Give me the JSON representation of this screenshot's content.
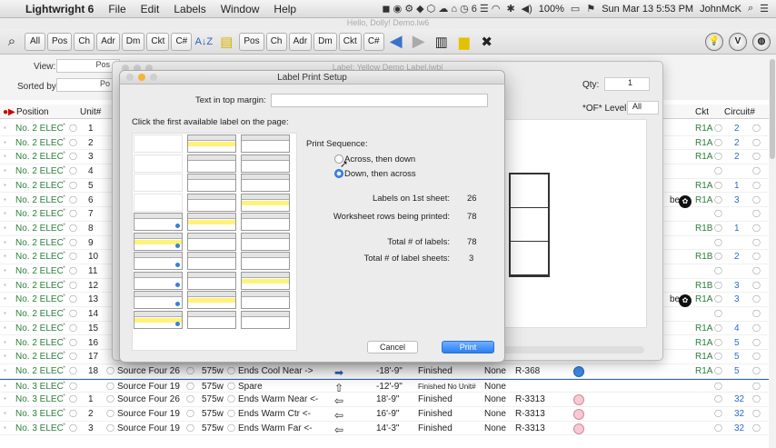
{
  "menubar": {
    "app_name": "Lightwright 6",
    "menus": [
      "File",
      "Edit",
      "Labels",
      "Window",
      "Help"
    ],
    "battery": "100%",
    "datetime": "Sun Mar 13  5:53 PM",
    "user": "JohnMcK"
  },
  "document_title": "Hello, Dolly! Demo.lw6",
  "toolbar": {
    "group1": [
      "All",
      "Pos",
      "Ch",
      "Adr",
      "Dm",
      "Ckt",
      "C#"
    ],
    "group2": [
      "Pos",
      "Ch",
      "Adr",
      "Dm",
      "Ckt",
      "C#"
    ]
  },
  "filters": {
    "view_label": "View:",
    "view_value": "Pos",
    "sorted_label": "Sorted by:",
    "sorted_value": "Po"
  },
  "columns": {
    "position": "Position",
    "unit": "Unit#",
    "ckt": "Ckt",
    "circuit": "Circuit#"
  },
  "rows": [
    {
      "pos": "No. 2 ELEC",
      "unit": "1",
      "ckt": "R1A",
      "cir": "2"
    },
    {
      "pos": "No. 2 ELEC",
      "unit": "2",
      "ckt": "R1A",
      "cir": "2"
    },
    {
      "pos": "No. 2 ELEC",
      "unit": "3",
      "ckt": "R1A",
      "cir": "2"
    },
    {
      "pos": "No. 2 ELEC",
      "unit": "4",
      "ckt": "",
      "cir": ""
    },
    {
      "pos": "No. 2 ELEC",
      "unit": "5",
      "ckt": "R1A",
      "cir": "1"
    },
    {
      "pos": "No. 2 ELEC",
      "unit": "6",
      "ckt": "R1A",
      "cir": "3"
    },
    {
      "pos": "No. 2 ELEC",
      "unit": "7",
      "ckt": "",
      "cir": ""
    },
    {
      "pos": "No. 2 ELEC",
      "unit": "8",
      "ckt": "R1B",
      "cir": "1"
    },
    {
      "pos": "No. 2 ELEC",
      "unit": "9",
      "ckt": "",
      "cir": ""
    },
    {
      "pos": "No. 2 ELEC",
      "unit": "10",
      "ckt": "R1B",
      "cir": "2"
    },
    {
      "pos": "No. 2 ELEC",
      "unit": "11",
      "ckt": "",
      "cir": ""
    },
    {
      "pos": "No. 2 ELEC",
      "unit": "12",
      "ckt": "R1B",
      "cir": "3"
    },
    {
      "pos": "No. 2 ELEC",
      "unit": "13",
      "ckt": "R1A",
      "cir": "3"
    },
    {
      "pos": "No. 2 ELEC",
      "unit": "14",
      "ckt": "",
      "cir": ""
    },
    {
      "pos": "No. 2 ELEC",
      "unit": "15",
      "ckt": "R1A",
      "cir": "4"
    },
    {
      "pos": "No. 2 ELEC",
      "unit": "16",
      "ckt": "R1A",
      "cir": "5"
    },
    {
      "pos": "No. 2 ELEC",
      "unit": "17",
      "ckt": "R1A",
      "cir": "5"
    },
    {
      "pos": "No. 2 ELEC",
      "unit": "18",
      "purpose": "Source Four 26",
      "watt": "575w",
      "focus": "Ends Cool Near ->",
      "arrow": "➡",
      "gel": "-18'-9\"",
      "status": "Finished",
      "none": "None",
      "color": "R-368",
      "swatch": "#3b86e0",
      "ckt": "R1A",
      "cir": "5"
    },
    {
      "pos": "No. 3 ELEC",
      "unit": "",
      "purpose": "Source Four 19",
      "watt": "575w",
      "focus": "Spare",
      "arrow": "⇧",
      "gel": "-12'-9\"",
      "status": "Finished No Unit#",
      "none": "None",
      "color": "",
      "swatch": "",
      "ckt": "",
      "cir": ""
    },
    {
      "pos": "No. 3 ELEC",
      "unit": "1",
      "purpose": "Source Four 26",
      "watt": "575w",
      "focus": "Ends Warm Near <-",
      "arrow": "⇦",
      "gel": "18'-9\"",
      "status": "Finished",
      "none": "None",
      "color": "R-3313",
      "swatch": "#f7c9d2",
      "ckt": "",
      "cir": "32"
    },
    {
      "pos": "No. 3 ELEC",
      "unit": "2",
      "purpose": "Source Four 19",
      "watt": "575w",
      "focus": "Ends Warm Ctr <-",
      "arrow": "⇦",
      "gel": "16'-9\"",
      "status": "Finished",
      "none": "None",
      "color": "R-3313",
      "swatch": "#f7c9d2",
      "ckt": "",
      "cir": "32"
    },
    {
      "pos": "No. 3 ELEC",
      "unit": "3",
      "purpose": "Source Four 19",
      "watt": "575w",
      "focus": "Ends Warm Far <-",
      "arrow": "⇦",
      "gel": "14'-3\"",
      "status": "Finished",
      "none": "None",
      "color": "R-3313",
      "swatch": "#f7c9d2",
      "ckt": "",
      "cir": "32"
    }
  ],
  "bubbles": [
    {
      "row": 5,
      "text": "be"
    },
    {
      "row": 12,
      "text": "be"
    }
  ],
  "bg_window": {
    "title": "Label: Yellow Demo Label.lwbl",
    "qty_label": "Qty:",
    "qty_value": "1",
    "level_label": "*OF* Level:",
    "level_value": "All"
  },
  "dialog": {
    "title": "Label Print Setup",
    "margin_label": "Text in top margin:",
    "instruction": "Click the first available label on the page:",
    "sequence_label": "Print Sequence:",
    "option_across": "Across, then down",
    "option_down": "Down, then across",
    "selected_option": "down",
    "stats": [
      {
        "label": "Labels on 1st sheet:",
        "value": "26"
      },
      {
        "label": "Worksheet rows being printed:",
        "value": "78"
      },
      {
        "label": "Total # of labels:",
        "value": "78"
      },
      {
        "label": "Total # of label sheets:",
        "value": "3"
      }
    ],
    "cancel": "Cancel",
    "print": "Print"
  }
}
